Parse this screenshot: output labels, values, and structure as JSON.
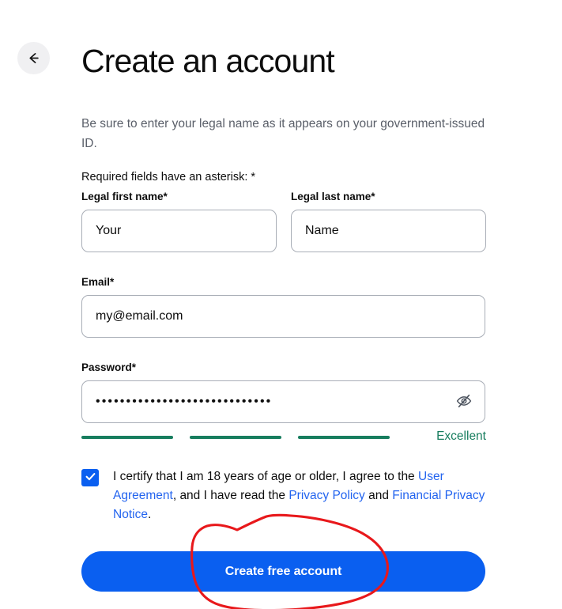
{
  "page": {
    "title": "Create an account",
    "subtitle": "Be sure to enter your legal name as it appears on your government-issued ID.",
    "required_note": "Required fields have an asterisk: *"
  },
  "nav": {
    "back_icon": "arrow-left-icon",
    "back_label": "Back"
  },
  "form": {
    "first_name": {
      "label": "Legal first name*",
      "value": "Your",
      "placeholder": "Legal first name"
    },
    "last_name": {
      "label": "Legal last name*",
      "value": "Name",
      "placeholder": "Legal last name"
    },
    "email": {
      "label": "Email*",
      "value": "my@email.com",
      "placeholder": "Email"
    },
    "password": {
      "label": "Password*",
      "masked_value": "•••••••••••••••••••••••••••••",
      "placeholder": "Password",
      "toggle_icon": "eye-slash-icon",
      "toggle_label": "Show password"
    },
    "strength": {
      "label": "Excellent",
      "filled_segments": 3,
      "total_segments": 3,
      "color": "#177d5e"
    },
    "consent": {
      "checked": true,
      "check_icon": "checkmark-icon",
      "text_part_1": "I certify that I am 18 years of age or older, I agree to the ",
      "link_1": "User Agreement",
      "text_part_2": ", and I have read the ",
      "link_2": "Privacy Policy",
      "text_part_3": " and ",
      "link_3": "Financial Privacy Notice",
      "text_part_4": "."
    },
    "submit_label": "Create free account"
  },
  "annotation": {
    "shape": "hand-drawn-circle-with-tail",
    "color": "#e8181b",
    "target": "Create free account button"
  },
  "colors": {
    "brand_blue": "#0a5ff0",
    "link_blue": "#2364ef",
    "success_green": "#177d5e",
    "annotation_red": "#e8181b",
    "text": "#0d0d0d",
    "muted_text": "#5a5f69",
    "input_border": "#a9aeb7"
  }
}
